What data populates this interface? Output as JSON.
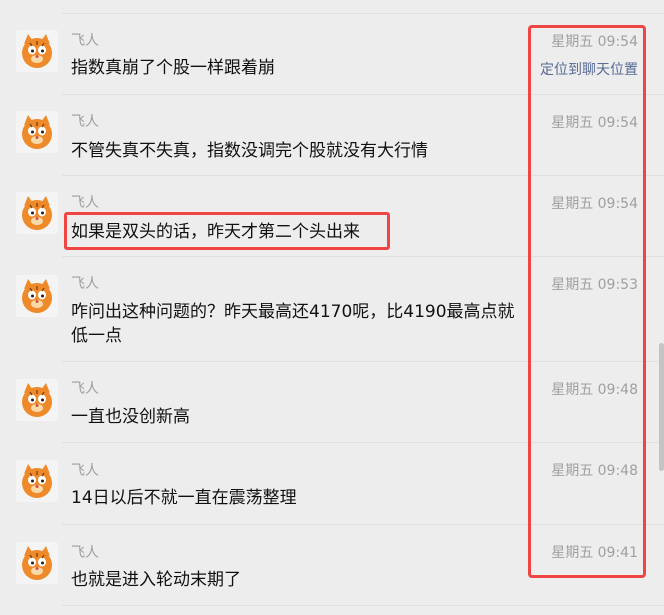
{
  "messages": [
    {
      "sender": "飞人",
      "text": "指数真崩了个股一样跟着崩",
      "time": "星期五 09:54",
      "locate": "定位到聊天位置"
    },
    {
      "sender": "飞人",
      "text": "不管失真不失真，指数没调完个股就没有大行情",
      "time": "星期五 09:54"
    },
    {
      "sender": "飞人",
      "text": "如果是双头的话，昨天才第二个头出来",
      "time": "星期五 09:54"
    },
    {
      "sender": "飞人",
      "text": "咋问出这种问题的？昨天最高还4170呢，比4190最高点就低一点",
      "time": "星期五 09:53"
    },
    {
      "sender": "飞人",
      "text": "一直也没创新高",
      "time": "星期五 09:48"
    },
    {
      "sender": "飞人",
      "text": "14日以后不就一直在震荡整理",
      "time": "星期五 09:48"
    },
    {
      "sender": "飞人",
      "text": "也就是进入轮动末期了",
      "time": "星期五 09:41"
    }
  ],
  "avatar_icon": "garfield-cat-avatar-icon",
  "colors": {
    "highlight": "#f04545",
    "link": "#576b95",
    "background": "#ededed"
  }
}
